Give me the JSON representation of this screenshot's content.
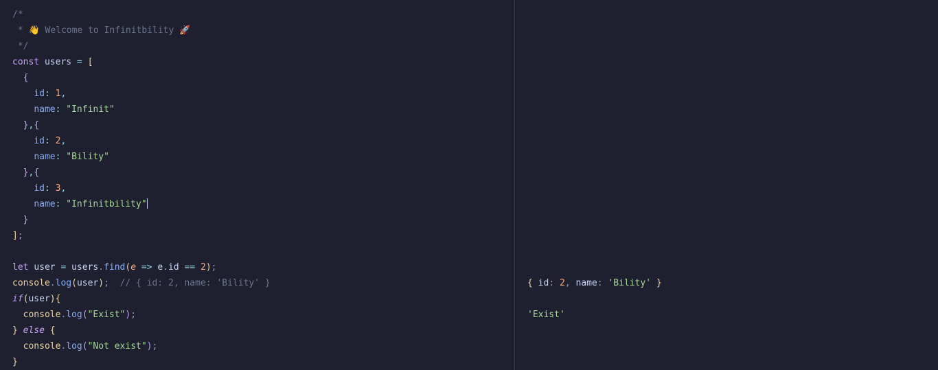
{
  "code": {
    "commentOpen": "/*",
    "commentWelcome": " * 👋 Welcome to Infinitbility 🚀",
    "commentClose": " */",
    "kwConst": "const",
    "usersVar": "users",
    "eq": " = ",
    "openBracket": "[",
    "u1id_key": "id",
    "u1id_val": "1",
    "u1name_key": "name",
    "u1name_val": "\"Infinit\"",
    "u2id_key": "id",
    "u2id_val": "2",
    "u2name_key": "name",
    "u2name_val": "\"Bility\"",
    "u3id_key": "id",
    "u3id_val": "3",
    "u3name_key": "name",
    "u3name_val": "\"Infinitbility\"",
    "closeBracket": "];",
    "kwLet": "let",
    "userVar": "user",
    "findCall_users": "users",
    "findCall_find": "find",
    "findCall_param": "e",
    "findCall_arrow": " => ",
    "findCall_e": "e",
    "findCall_id": "id",
    "findCall_eqeq": " == ",
    "findCall_two": "2",
    "console": "console",
    "log": "log",
    "logUserComment": "// { id: 2, name: 'Bility' }",
    "kwIf": "if",
    "existStr": "\"Exist\"",
    "kwElse": "else",
    "notExistStr": "\"Not exist\""
  },
  "output": {
    "line1_open": "{ ",
    "line1_idkey": "id",
    "line1_colon1": ": ",
    "line1_idval": "2",
    "line1_comma": ", ",
    "line1_namekey": "name",
    "line1_colon2": ": ",
    "line1_nameval": "'Bility'",
    "line1_close": " }",
    "line2": "'Exist'"
  }
}
